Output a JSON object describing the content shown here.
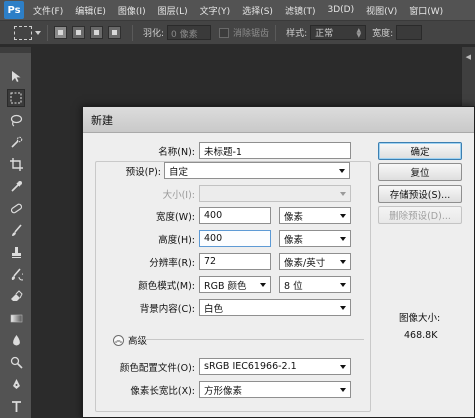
{
  "app": {
    "logo": "Ps"
  },
  "menu": [
    "文件(F)",
    "编辑(E)",
    "图像(I)",
    "图层(L)",
    "文字(Y)",
    "选择(S)",
    "滤镜(T)",
    "3D(D)",
    "视图(V)",
    "窗口(W)"
  ],
  "options_bar": {
    "feather_label": "羽化:",
    "feather_value": "0 像素",
    "antialias_label": "消除锯齿",
    "style_label": "样式:",
    "style_value": "正常",
    "width_label": "宽度:"
  },
  "dialog": {
    "title": "新建",
    "name_label": "名称(N):",
    "name_value": "未标题-1",
    "preset_label": "预设(P):",
    "preset_value": "自定",
    "size_label": "大小(I):",
    "width_label": "宽度(W):",
    "width_value": "400",
    "width_unit": "像素",
    "height_label": "高度(H):",
    "height_value": "400",
    "height_unit": "像素",
    "resolution_label": "分辨率(R):",
    "resolution_value": "72",
    "resolution_unit": "像素/英寸",
    "color_mode_label": "颜色模式(M):",
    "color_mode_value": "RGB 颜色",
    "bit_depth_value": "8 位",
    "background_label": "背景内容(C):",
    "background_value": "白色",
    "advanced_label": "高级",
    "color_profile_label": "颜色配置文件(O):",
    "color_profile_value": "sRGB IEC61966-2.1",
    "pixel_aspect_label": "像素长宽比(X):",
    "pixel_aspect_value": "方形像素",
    "image_size_label": "图像大小:",
    "image_size_value": "468.8K",
    "buttons": {
      "ok": "确定",
      "reset": "复位",
      "save_preset": "存储预设(S)...",
      "delete_preset": "删除预设(D)..."
    }
  }
}
